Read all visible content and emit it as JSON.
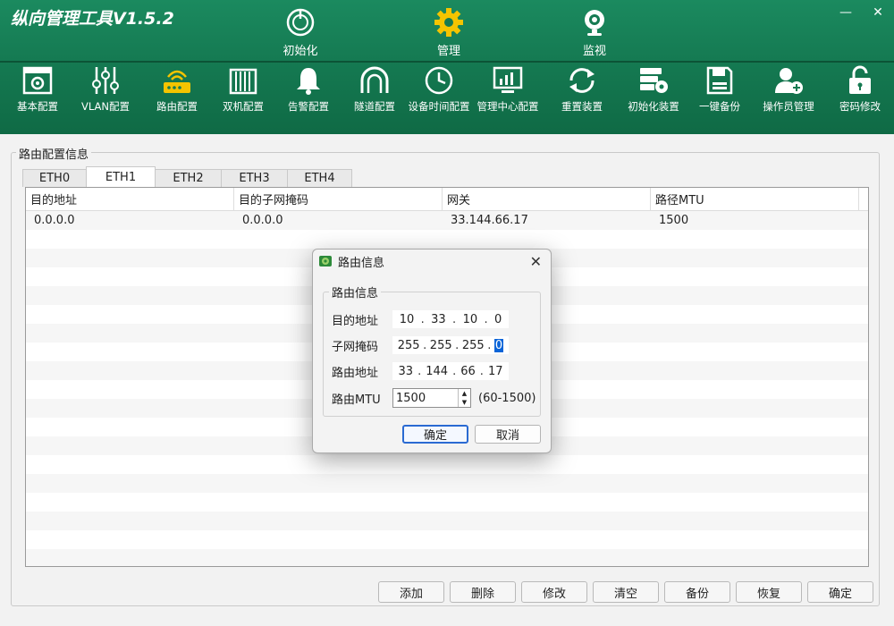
{
  "app": {
    "title": "纵向管理工具V1.5.2",
    "minimize": "—",
    "close": "✕"
  },
  "main_tabs": [
    {
      "label": "初始化",
      "icon": "power-icon"
    },
    {
      "label": "管理",
      "icon": "gear-icon"
    },
    {
      "label": "监视",
      "icon": "webcam-icon"
    }
  ],
  "toolbar": [
    {
      "label": "基本配置",
      "icon": "config-panel-icon"
    },
    {
      "label": "VLAN配置",
      "icon": "sliders-icon"
    },
    {
      "label": "路由配置",
      "icon": "router-icon"
    },
    {
      "label": "双机配置",
      "icon": "dual-machine-icon"
    },
    {
      "label": "告警配置",
      "icon": "bell-icon"
    },
    {
      "label": "隧道配置",
      "icon": "tunnel-icon"
    },
    {
      "label": "设备时间配置",
      "icon": "clock-icon"
    },
    {
      "label": "管理中心配置",
      "icon": "monitor-chart-icon"
    },
    {
      "label": "重置装置",
      "icon": "refresh-icon"
    },
    {
      "label": "初始化装置",
      "icon": "server-gear-icon"
    },
    {
      "label": "一键备份",
      "icon": "save-disk-icon"
    },
    {
      "label": "操作员管理",
      "icon": "add-user-icon"
    },
    {
      "label": "密码修改",
      "icon": "unlock-icon"
    }
  ],
  "panel": {
    "group_title": "路由配置信息",
    "eth_tabs": [
      "ETH0",
      "ETH1",
      "ETH2",
      "ETH3",
      "ETH4"
    ],
    "active_tab": "ETH1",
    "columns": [
      "目的地址",
      "目的子网掩码",
      "网关",
      "路径MTU"
    ],
    "rows": [
      [
        "0.0.0.0",
        "0.0.0.0",
        "33.144.66.17",
        "1500"
      ]
    ],
    "buttons": [
      "添加",
      "删除",
      "修改",
      "清空",
      "备份",
      "恢复",
      "确定"
    ]
  },
  "dialog": {
    "title": "路由信息",
    "group_title": "路由信息",
    "dest_label": "目的地址",
    "dest_ip": [
      "10",
      "33",
      "10",
      "0"
    ],
    "mask_label": "子网掩码",
    "mask_ip": [
      "255",
      "255",
      "255",
      "0"
    ],
    "gateway_label": "路由地址",
    "gateway_ip": [
      "33",
      "144",
      "66",
      "17"
    ],
    "mtu_label": "路由MTU",
    "mtu_value": "1500",
    "mtu_range": "(60-1500)",
    "ok_label": "确定",
    "cancel_label": "取消"
  }
}
